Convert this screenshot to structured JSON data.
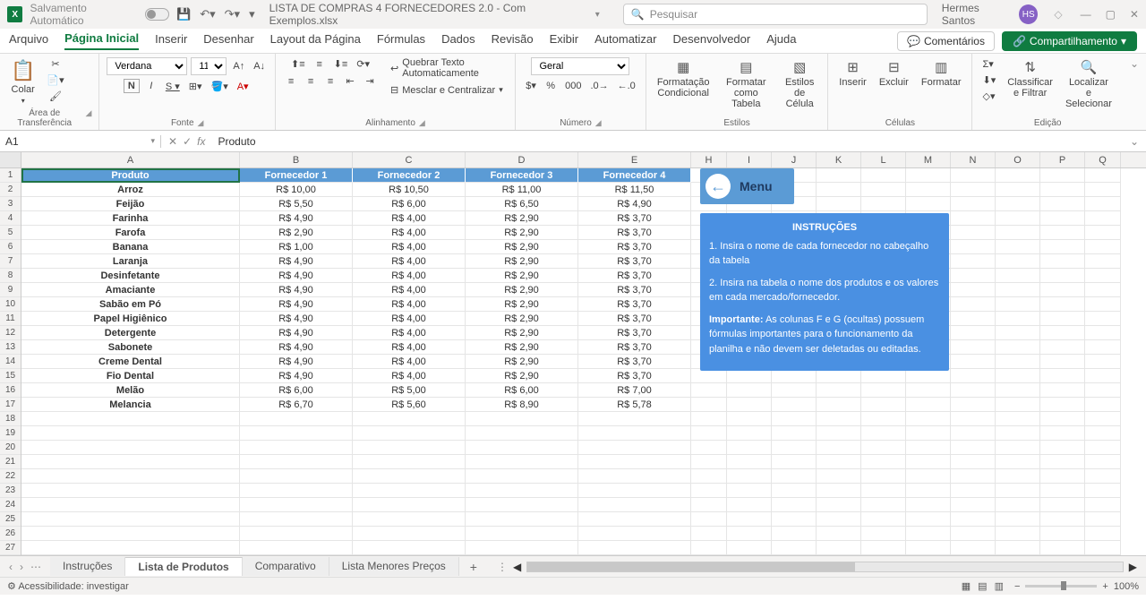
{
  "title": {
    "autosave": "Salvamento Automático",
    "filename": "LISTA DE COMPRAS 4 FORNECEDORES 2.0 - Com Exemplos.xlsx",
    "search_placeholder": "Pesquisar",
    "user_name": "Hermes Santos",
    "user_initials": "HS"
  },
  "tabs": {
    "arquivo": "Arquivo",
    "pagina_inicial": "Página Inicial",
    "inserir": "Inserir",
    "desenhar": "Desenhar",
    "layout": "Layout da Página",
    "formulas": "Fórmulas",
    "dados": "Dados",
    "revisao": "Revisão",
    "exibir": "Exibir",
    "automatizar": "Automatizar",
    "desenvolvedor": "Desenvolvedor",
    "ajuda": "Ajuda",
    "comentarios": "Comentários",
    "compartilhamento": "Compartilhamento"
  },
  "ribbon": {
    "colar": "Colar",
    "area_transferencia": "Área de Transferência",
    "font_name": "Verdana",
    "font_size": "11",
    "fonte": "Fonte",
    "alinhamento": "Alinhamento",
    "wrap_text": "Quebrar Texto Automaticamente",
    "merge_center": "Mesclar e Centralizar",
    "number_format": "Geral",
    "numero": "Número",
    "cond_format": "Formatação Condicional",
    "format_table": "Formatar como Tabela",
    "cell_styles": "Estilos de Célula",
    "estilos": "Estilos",
    "inserir": "Inserir",
    "excluir": "Excluir",
    "formatar": "Formatar",
    "celulas": "Células",
    "sort_filter": "Classificar e Filtrar",
    "find_select": "Localizar e Selecionar",
    "edicao": "Edição"
  },
  "formula_bar": {
    "cell_ref": "A1",
    "formula": "Produto"
  },
  "columns": [
    "A",
    "B",
    "C",
    "D",
    "E",
    "H",
    "I",
    "J",
    "K",
    "L",
    "M",
    "N",
    "O",
    "P",
    "Q"
  ],
  "headers": [
    "Produto",
    "Fornecedor 1",
    "Fornecedor 2",
    "Fornecedor 3",
    "Fornecedor 4"
  ],
  "rows": [
    [
      "Arroz",
      "R$ 10,00",
      "R$ 10,50",
      "R$ 11,00",
      "R$ 11,50"
    ],
    [
      "Feijão",
      "R$ 5,50",
      "R$ 6,00",
      "R$ 6,50",
      "R$ 4,90"
    ],
    [
      "Farinha",
      "R$ 4,90",
      "R$ 4,00",
      "R$ 2,90",
      "R$ 3,70"
    ],
    [
      "Farofa",
      "R$ 2,90",
      "R$ 4,00",
      "R$ 2,90",
      "R$ 3,70"
    ],
    [
      "Banana",
      "R$ 1,00",
      "R$ 4,00",
      "R$ 2,90",
      "R$ 3,70"
    ],
    [
      "Laranja",
      "R$ 4,90",
      "R$ 4,00",
      "R$ 2,90",
      "R$ 3,70"
    ],
    [
      "Desinfetante",
      "R$ 4,90",
      "R$ 4,00",
      "R$ 2,90",
      "R$ 3,70"
    ],
    [
      "Amaciante",
      "R$ 4,90",
      "R$ 4,00",
      "R$ 2,90",
      "R$ 3,70"
    ],
    [
      "Sabão em Pó",
      "R$ 4,90",
      "R$ 4,00",
      "R$ 2,90",
      "R$ 3,70"
    ],
    [
      "Papel Higiênico",
      "R$ 4,90",
      "R$ 4,00",
      "R$ 2,90",
      "R$ 3,70"
    ],
    [
      "Detergente",
      "R$ 4,90",
      "R$ 4,00",
      "R$ 2,90",
      "R$ 3,70"
    ],
    [
      "Sabonete",
      "R$ 4,90",
      "R$ 4,00",
      "R$ 2,90",
      "R$ 3,70"
    ],
    [
      "Creme Dental",
      "R$ 4,90",
      "R$ 4,00",
      "R$ 2,90",
      "R$ 3,70"
    ],
    [
      "Fio Dental",
      "R$ 4,90",
      "R$ 4,00",
      "R$ 2,90",
      "R$ 3,70"
    ],
    [
      "Melão",
      "R$ 6,00",
      "R$ 5,00",
      "R$ 6,00",
      "R$ 7,00"
    ],
    [
      "Melancia",
      "R$ 6,70",
      "R$ 5,60",
      "R$ 8,90",
      "R$ 5,78"
    ]
  ],
  "empty_rows": 10,
  "overlay": {
    "menu": "Menu",
    "title": "INSTRUÇÕES",
    "line1": "1. Insira o nome de cada fornecedor no cabeçalho da tabela",
    "line2": "2. Insira na tabela o nome dos produtos e os valores em cada mercado/fornecedor.",
    "important_label": "Importante:",
    "important_text": " As colunas F e G (ocultas) possuem fórmulas importantes para o funcionamento da planilha e não devem ser deletadas ou editadas."
  },
  "sheets": {
    "instrucoes": "Instruções",
    "lista": "Lista de Produtos",
    "comparativo": "Comparativo",
    "menores": "Lista Menores Preços"
  },
  "status": {
    "accessibility": "Acessibilidade: investigar",
    "zoom": "100%"
  }
}
